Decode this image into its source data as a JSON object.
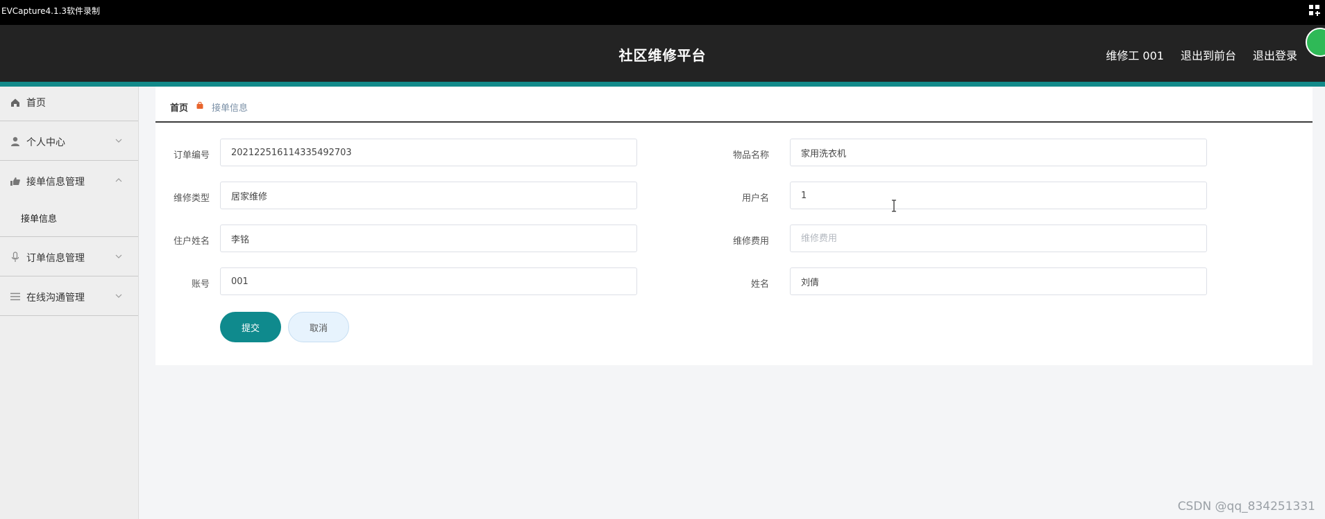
{
  "capture_bar": {
    "title": "EVCapture4.1.3软件录制"
  },
  "header": {
    "title": "社区维修平台",
    "user": "维修工 001",
    "exit_front": "退出到前台",
    "logout": "退出登录"
  },
  "sidebar": {
    "home": "首页",
    "personal_center": "个人中心",
    "order_accept_mgmt": "接单信息管理",
    "order_accept_info": "接单信息",
    "order_info_mgmt": "订单信息管理",
    "online_chat_mgmt": "在线沟通管理"
  },
  "breadcrumb": {
    "home": "首页",
    "current": "接单信息"
  },
  "form": {
    "order_no": {
      "label": "订单编号",
      "value": "202122516114335492703"
    },
    "item_name": {
      "label": "物品名称",
      "value": "家用洗衣机"
    },
    "repair_type": {
      "label": "维修类型",
      "value": "居家维修"
    },
    "username": {
      "label": "用户名",
      "value": "1"
    },
    "resident_name": {
      "label": "住户姓名",
      "value": "李铭"
    },
    "repair_fee": {
      "label": "维修费用",
      "value": "",
      "placeholder": "维修费用"
    },
    "account": {
      "label": "账号",
      "value": "001"
    },
    "name": {
      "label": "姓名",
      "value": "刘倩"
    },
    "submit": "提交",
    "cancel": "取消"
  },
  "watermark": "CSDN @qq_834251331",
  "colors": {
    "header_bg": "#232323",
    "accent_teal": "#138a8a",
    "submit_bg": "#0f8a8d",
    "breadcrumb_sep": "#e8642c"
  },
  "icons": [
    "home-icon",
    "user-icon",
    "order-accept-icon",
    "microphone-icon",
    "list-icon",
    "chevron-down-icon",
    "chevron-up-icon",
    "shopping-bag-icon",
    "text-cursor-icon"
  ]
}
